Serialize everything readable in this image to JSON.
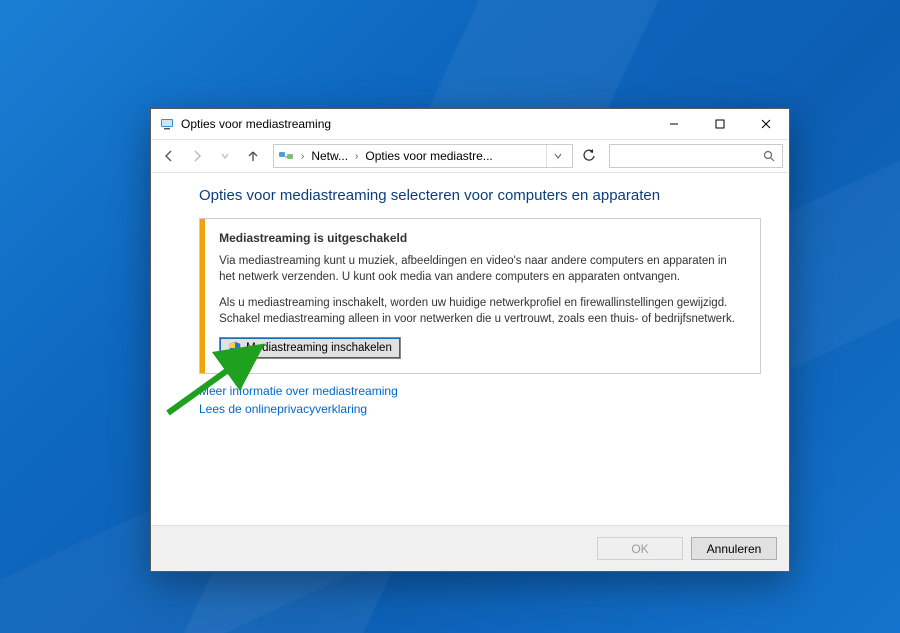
{
  "titlebar": {
    "title": "Opties voor mediastreaming"
  },
  "nav": {
    "crumb1": "Netw...",
    "crumb2": "Opties voor mediastre..."
  },
  "page": {
    "title": "Opties voor mediastreaming selecteren voor computers en apparaten",
    "panel": {
      "heading": "Mediastreaming is uitgeschakeld",
      "p1": "Via mediastreaming kunt u muziek, afbeeldingen en video's naar andere computers en apparaten in het netwerk verzenden. U kunt ook media van andere computers en apparaten ontvangen.",
      "p2": "Als u mediastreaming inschakelt, worden uw huidige netwerkprofiel en firewallinstellingen gewijzigd. Schakel mediastreaming alleen in voor netwerken die u vertrouwt, zoals een thuis- of bedrijfsnetwerk.",
      "enable_btn": "Mediastreaming inschakelen"
    },
    "link1": "Meer informatie over mediastreaming",
    "link2": "Lees de onlineprivacyverklaring"
  },
  "footer": {
    "ok": "OK",
    "cancel": "Annuleren"
  }
}
